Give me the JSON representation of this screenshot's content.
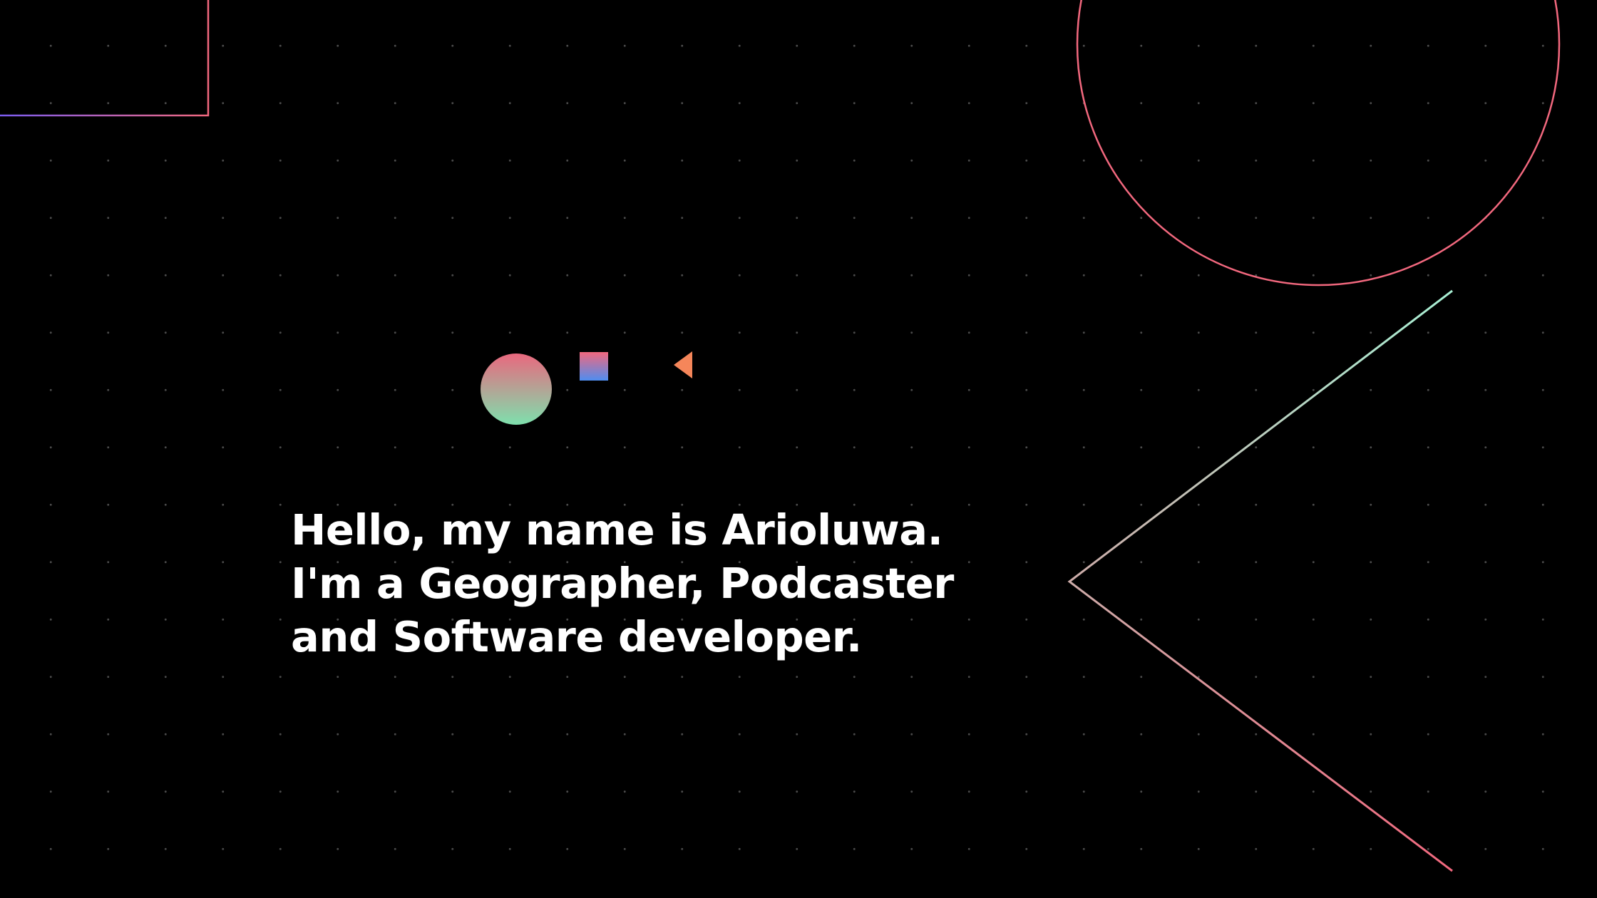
{
  "hero": {
    "line1": "Hello, my name is Arioluwa.",
    "line2": "I'm a Geographer, Podcaster",
    "line3": "and Software developer."
  },
  "decorations": {
    "icons": [
      "gradient-circle-icon",
      "gradient-square-icon",
      "orange-triangle-icon"
    ],
    "outlines": [
      "corner-rectangle-outline",
      "large-circle-outline",
      "large-triangle-outline",
      "vertical-line"
    ]
  },
  "colors": {
    "background": "#000000",
    "text": "#ffffff",
    "grid_dot": "#4a4a4a",
    "pink": "#f2687e",
    "mint": "#a8f0d4",
    "blue": "#4f8df0",
    "orange": "#f5865a",
    "purple": "#7a5cf0"
  }
}
